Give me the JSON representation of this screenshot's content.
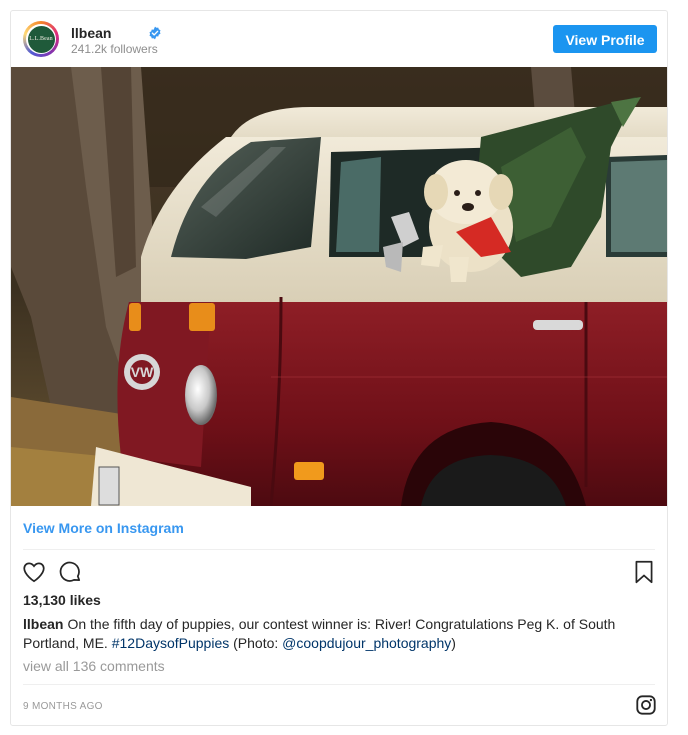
{
  "header": {
    "avatar_text": "L.L.Bean",
    "username": "llbean",
    "verified_icon": "verified-badge-icon",
    "followers": "241.2k followers",
    "view_profile_label": "View Profile"
  },
  "photo": {
    "description_icon": "post-image"
  },
  "view_more_label": "View More on Instagram",
  "actions": {
    "like_icon": "heart-icon",
    "comment_icon": "comment-icon",
    "save_icon": "bookmark-icon"
  },
  "likes": "13,130 likes",
  "caption": {
    "username": "llbean",
    "text": "On the fifth day of puppies, our contest winner is: River! Congratulations Peg K. of South Portland, ME.",
    "hashtag": "#12DaysofPuppies",
    "photo_prefix": "(Photo:",
    "mention": "@coopdujour_photography",
    "photo_suffix": ")"
  },
  "comments_link": "view all 136 comments",
  "timestamp": "9 MONTHS AGO",
  "footer": {
    "logo_icon": "instagram-icon"
  },
  "colors": {
    "accent": "#1b95f0",
    "link": "#3897f0",
    "mention": "#003569"
  }
}
